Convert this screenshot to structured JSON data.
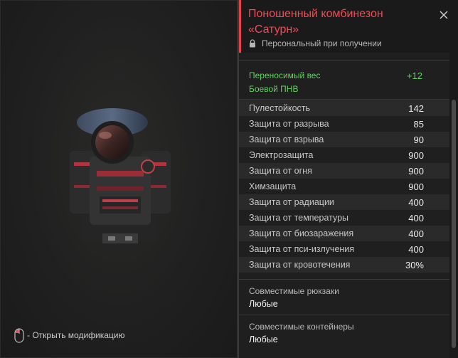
{
  "item": {
    "title": "Поношенный комбинезон «Сатурн»",
    "subtitle": "Персональный при получении"
  },
  "hint": {
    "text": "- Открыть модификацию"
  },
  "bonuses": {
    "line1": "Переносимый вес",
    "line2": "Боевой ПНВ",
    "value": "+12"
  },
  "stats": [
    {
      "name": "Пулестойкость",
      "value": "142"
    },
    {
      "name": "Защита от разрыва",
      "value": "85"
    },
    {
      "name": "Защита от взрыва",
      "value": "90"
    },
    {
      "name": "Электрозащита",
      "value": "900"
    },
    {
      "name": "Защита от огня",
      "value": "900"
    },
    {
      "name": "Химзащита",
      "value": "900"
    },
    {
      "name": "Защита от радиации",
      "value": "400"
    },
    {
      "name": "Защита от температуры",
      "value": "400"
    },
    {
      "name": "Защита от биозаражения",
      "value": "400"
    },
    {
      "name": "Защита от пси-излучения",
      "value": "400"
    },
    {
      "name": "Защита от кровотечения",
      "value": "30%"
    }
  ],
  "compat": {
    "backpacks_label": "Совместимые рюкзаки",
    "backpacks_value": "Любые",
    "containers_label": "Совместимые контейнеры",
    "containers_value": "Любые"
  },
  "colors": {
    "accent": "#e8404d",
    "positive": "#5fd35f",
    "background": "#1f1f1f"
  },
  "icons": [
    "mouse-left-click-icon",
    "lock-icon",
    "close-icon"
  ]
}
